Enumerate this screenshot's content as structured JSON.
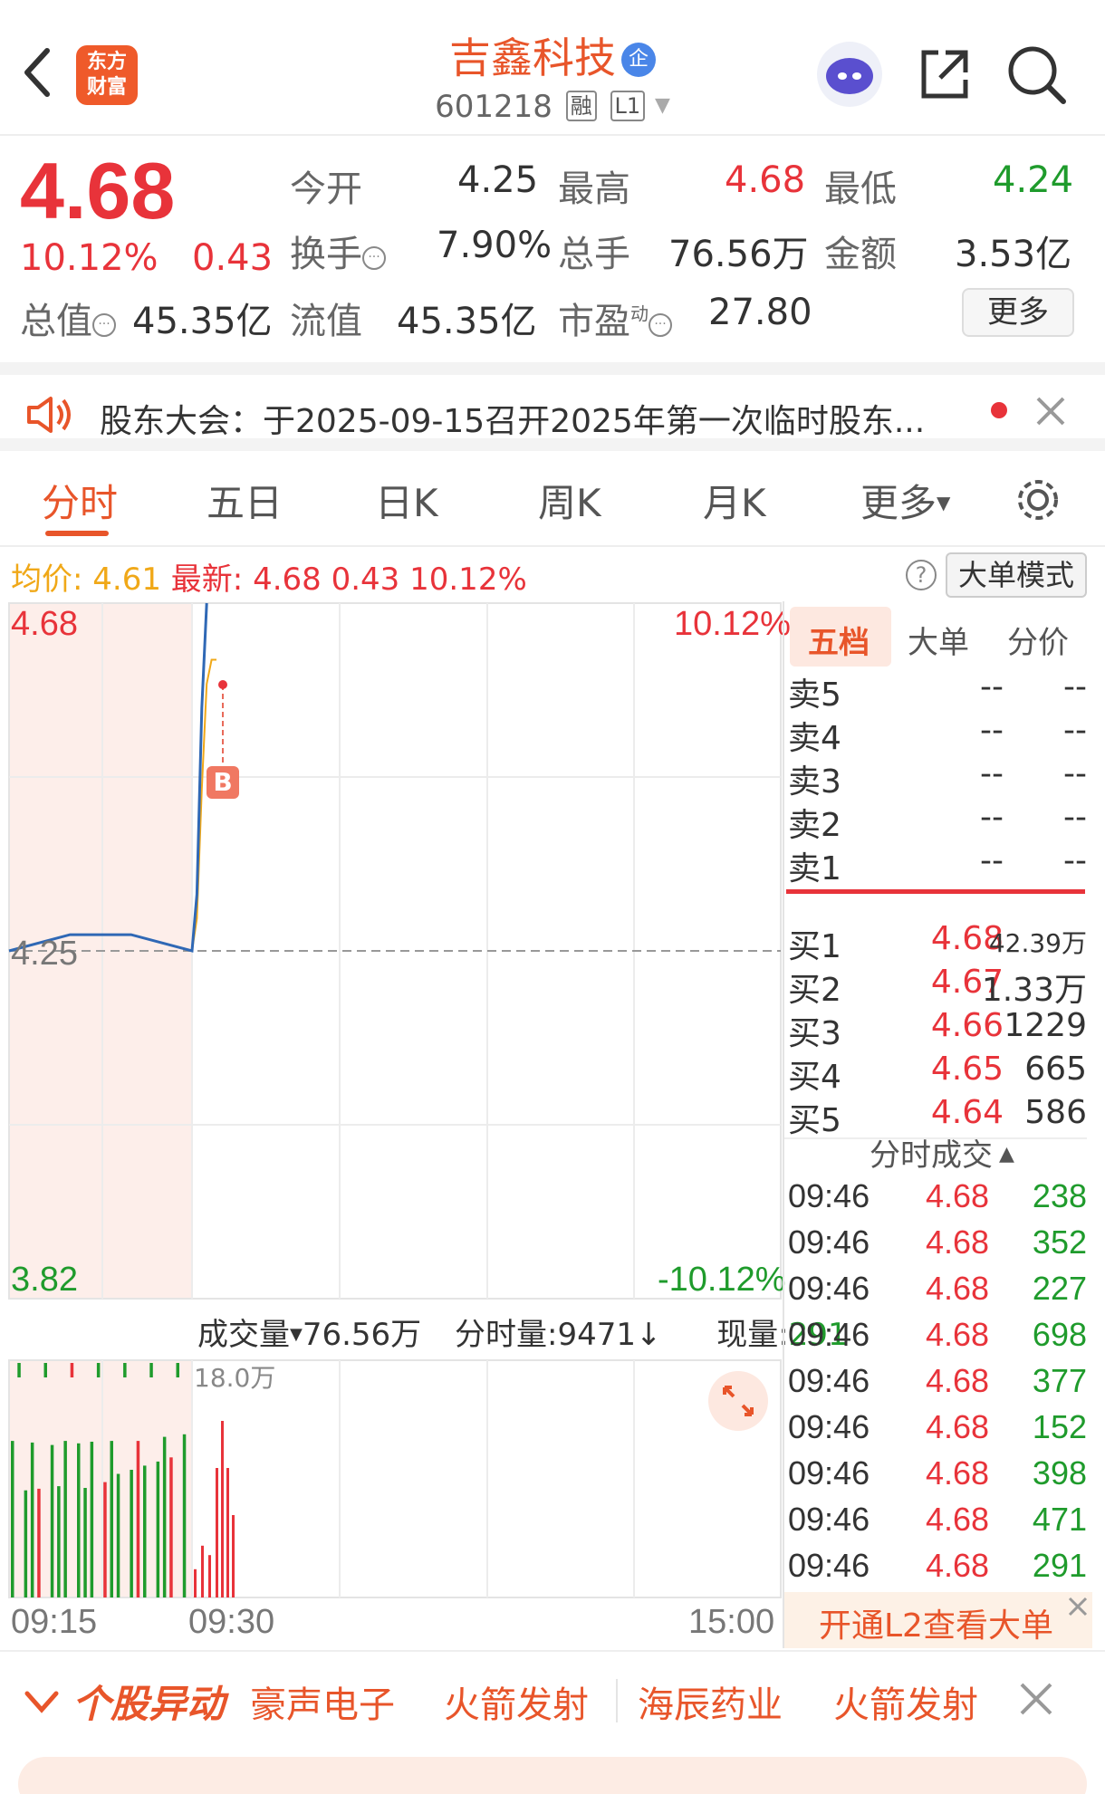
{
  "header": {
    "logo_line1": "东方",
    "logo_line2": "财富",
    "stock_name": "吉鑫科技",
    "badge": "企",
    "stock_code": "601218",
    "tag_margin": "融",
    "tag_level": "L1"
  },
  "quote": {
    "price": "4.68",
    "change_pct": "10.12%",
    "change_amt": "0.43",
    "open_label": "今开",
    "open_value": "4.25",
    "high_label": "最高",
    "high_value": "4.68",
    "low_label": "最低",
    "low_value": "4.24",
    "turnover_label": "换手",
    "turnover_value": "7.90%",
    "volume_label": "总手",
    "volume_value": "76.56万",
    "amount_label": "金额",
    "amount_value": "3.53亿",
    "mktcap_label": "总值",
    "mktcap_value": "45.35亿",
    "float_label": "流值",
    "float_value": "45.35亿",
    "pe_label": "市盈",
    "pe_sup": "动",
    "pe_value": "27.80",
    "more_button": "更多"
  },
  "notice": {
    "text": "股东大会：于2025-09-15召开2025年第一次临时股东..."
  },
  "tabs": [
    "分时",
    "五日",
    "日K",
    "周K",
    "月K",
    "更多"
  ],
  "infoline": {
    "avg_label": "均价:",
    "avg_value": "4.61",
    "latest_label": "最新:",
    "latest_value": "4.68",
    "change_amt": "0.43",
    "change_pct": "10.12%",
    "help": "?",
    "big_mode_button": "大单模式"
  },
  "chart": {
    "y_top": "4.68",
    "y_mid": "4.25",
    "y_bottom": "3.82",
    "pct_top": "10.12%",
    "pct_bottom": "-10.12%",
    "buy_marker": "B",
    "volume_label": "成交量",
    "volume_total": "76.56万",
    "tick_volume": "分时量:9471↓",
    "current_volume_label": "现量:",
    "current_volume_value": "291",
    "vol_axis_max": "18.0万",
    "time_start": "09:15",
    "time_open": "09:30",
    "time_end": "15:00"
  },
  "chart_data": {
    "type": "line",
    "y_range": [
      3.82,
      4.68
    ],
    "prev_close": 4.25,
    "series": [
      {
        "name": "均价",
        "color": "#f0a818",
        "x": [
          "09:30",
          "09:31",
          "09:32",
          "09:33",
          "09:34",
          "09:35"
        ],
        "values": [
          4.25,
          4.29,
          4.45,
          4.58,
          4.61,
          4.61
        ]
      },
      {
        "name": "最新",
        "color": "#2f68b5",
        "x": [
          "09:15",
          "09:20",
          "09:25",
          "09:30",
          "09:31",
          "09:32",
          "09:33"
        ],
        "values": [
          4.25,
          4.27,
          4.27,
          4.25,
          4.32,
          4.55,
          4.68
        ]
      }
    ]
  },
  "order_book": {
    "tabs": [
      "五档",
      "大单",
      "分价"
    ],
    "asks": [
      {
        "label": "卖5",
        "price": "--",
        "vol": "--"
      },
      {
        "label": "卖4",
        "price": "--",
        "vol": "--"
      },
      {
        "label": "卖3",
        "price": "--",
        "vol": "--"
      },
      {
        "label": "卖2",
        "price": "--",
        "vol": "--"
      },
      {
        "label": "卖1",
        "price": "--",
        "vol": "--"
      }
    ],
    "bids": [
      {
        "label": "买1",
        "price": "4.68",
        "vol": "42.39万"
      },
      {
        "label": "买2",
        "price": "4.67",
        "vol": "1.33万"
      },
      {
        "label": "买3",
        "price": "4.66",
        "vol": "1229"
      },
      {
        "label": "买4",
        "price": "4.65",
        "vol": "665"
      },
      {
        "label": "买5",
        "price": "4.64",
        "vol": "586"
      }
    ]
  },
  "trades": {
    "title": "分时成交",
    "rows": [
      {
        "time": "09:46",
        "price": "4.68",
        "vol": "238"
      },
      {
        "time": "09:46",
        "price": "4.68",
        "vol": "352"
      },
      {
        "time": "09:46",
        "price": "4.68",
        "vol": "227"
      },
      {
        "time": "09:46",
        "price": "4.68",
        "vol": "698"
      },
      {
        "time": "09:46",
        "price": "4.68",
        "vol": "377"
      },
      {
        "time": "09:46",
        "price": "4.68",
        "vol": "152"
      },
      {
        "time": "09:46",
        "price": "4.68",
        "vol": "398"
      },
      {
        "time": "09:46",
        "price": "4.68",
        "vol": "471"
      },
      {
        "time": "09:46",
        "price": "4.68",
        "vol": "291"
      }
    ]
  },
  "l2_banner": "开通L2查看大单",
  "bottom_bar": {
    "label": "个股异动",
    "items": [
      "豪声电子",
      "火箭发射",
      "海辰药业",
      "火箭发射"
    ]
  },
  "colors": {
    "up": "#e8333a",
    "down": "#1f9b2c",
    "brand": "#e8552a",
    "price_line": "#2f68b5",
    "avg_line": "#f0a818"
  }
}
